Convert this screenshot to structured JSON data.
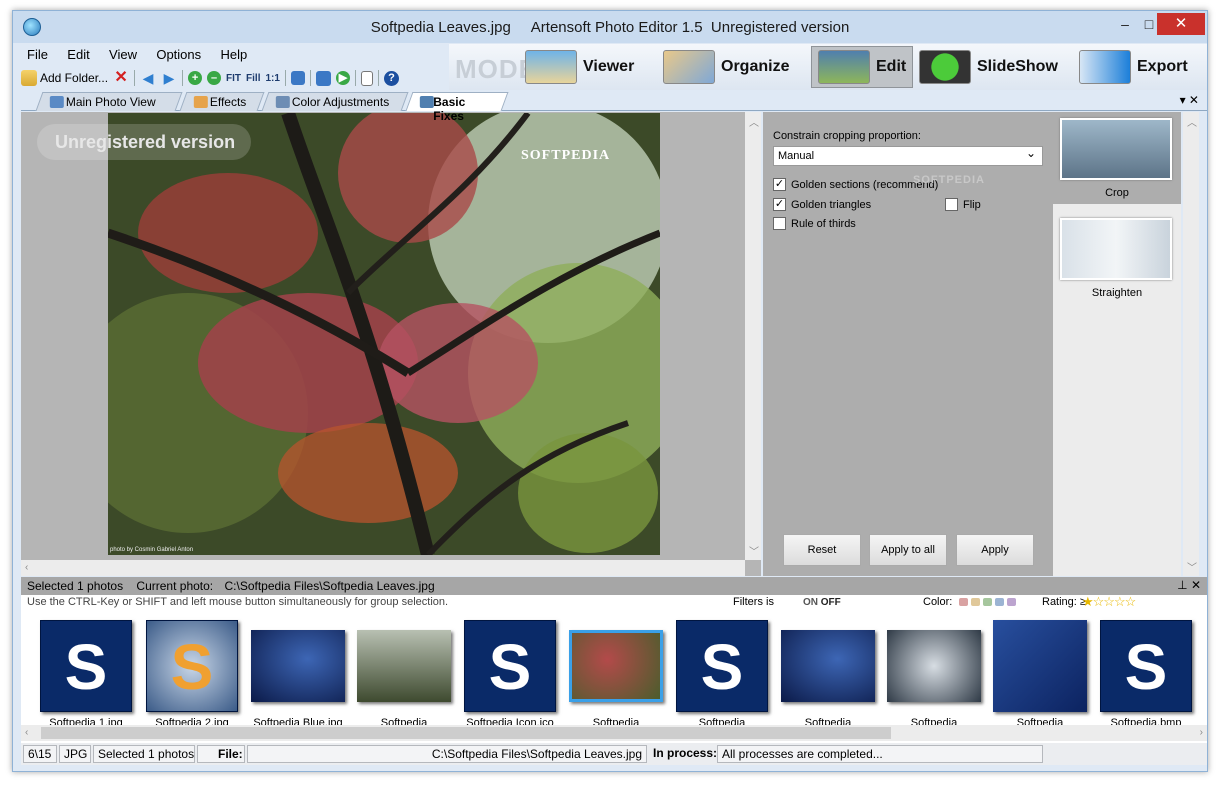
{
  "window": {
    "title": "Softpedia Leaves.jpg     Artensoft Photo Editor 1.5  Unregistered version",
    "minimize": "–",
    "maximize": "□",
    "close": "✕"
  },
  "menu": [
    "File",
    "Edit",
    "View",
    "Options",
    "Help"
  ],
  "toolbar": {
    "add_folder": "Add Folder...",
    "fit": "FIT",
    "fill": "Fill",
    "one_to_one": "1:1",
    "help": "?"
  },
  "modes": {
    "label": "MODE:",
    "items": [
      "Viewer",
      "Organize",
      "Edit",
      "SlideShow",
      "Export"
    ],
    "active": "Edit"
  },
  "tabs": [
    "Main Photo View",
    "Effects",
    "Color Adjustments",
    "Basic Fixes"
  ],
  "tab_tools": "▾  ✕",
  "viewer": {
    "watermark": "Unregistered version",
    "photo_label": "SOFTPEDIA",
    "photo_credit": "photo by Cosmin Gabriel Anton"
  },
  "panel": {
    "constrain_label": "Constrain cropping proportion:",
    "constrain_value": "Manual",
    "options": {
      "golden_sections": {
        "label": "Golden sections (recommend)",
        "checked": "✓"
      },
      "golden_triangles": {
        "label": "Golden triangles",
        "checked": "✓"
      },
      "flip": {
        "label": "Flip",
        "checked": ""
      },
      "rule_of_thirds": {
        "label": "Rule of thirds",
        "checked": ""
      }
    },
    "mini_watermark": "SOFTPEDIA",
    "reset": "Reset",
    "apply_all": "Apply to all",
    "apply": "Apply"
  },
  "tools": [
    "Crop",
    "Straighten"
  ],
  "filmstrip": {
    "selected_label": "Selected 1  photos",
    "current_photo_label": "Current photo:",
    "current_photo": "C:\\Softpedia Files\\Softpedia Leaves.jpg",
    "pin": "⊥  ✕",
    "hint": "Use the CTRL-Key or SHIFT and  left mouse button simultaneously for group selection.",
    "filters_label": "Filters is",
    "filter_on": "ON",
    "filter_off": "OFF",
    "color_label": "Color:",
    "rating_label": "Rating: ≥",
    "rating_stars": "★☆☆☆☆",
    "swatch_colors": [
      "#d9a2a2",
      "#e0c89a",
      "#a6c69d",
      "#9cb4d3",
      "#bca4cf"
    ],
    "thumbnails": [
      {
        "caption": "Softpedia 1.jpg",
        "kind": "s"
      },
      {
        "caption": "Softpedia 2.jpg",
        "kind": "s2"
      },
      {
        "caption": "Softpedia Blue.jpg",
        "kind": "blue"
      },
      {
        "caption": "Softpedia",
        "kind": "forest"
      },
      {
        "caption": "Softpedia Icon.ico",
        "kind": "s"
      },
      {
        "caption": "Softpedia",
        "kind": "leaves"
      },
      {
        "caption": "Softpedia",
        "kind": "s"
      },
      {
        "caption": "Softpedia",
        "kind": "blue"
      },
      {
        "caption": "Softpedia",
        "kind": "ice"
      },
      {
        "caption": "Softpedia",
        "kind": "blue2"
      },
      {
        "caption": "Softpedia.bmp",
        "kind": "s"
      }
    ]
  },
  "status": {
    "position": "6\\15",
    "format": "JPG",
    "selected": "Selected 1 photos",
    "file_label": "File:",
    "file_path": "C:\\Softpedia Files\\Softpedia Leaves.jpg",
    "in_process_label": "In process:",
    "process_text": "All processes are completed..."
  }
}
